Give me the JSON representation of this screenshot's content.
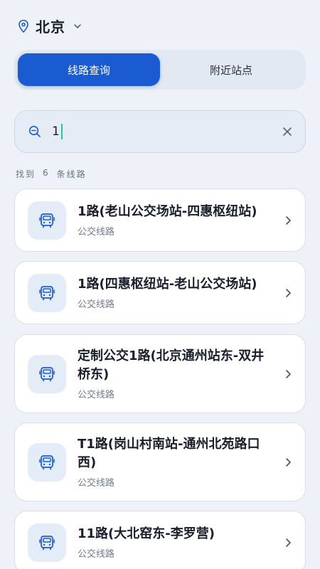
{
  "city": {
    "name": "北京"
  },
  "tabs": [
    {
      "label": "线路查询",
      "active": true
    },
    {
      "label": "附近站点",
      "active": false
    }
  ],
  "search": {
    "value": "1",
    "placeholder": ""
  },
  "results": {
    "prefix": "找到",
    "count": "6",
    "suffix": "条线路"
  },
  "routes": [
    {
      "name": "1路(老山公交场站-四惠枢纽站)",
      "type": "公交线路"
    },
    {
      "name": "1路(四惠枢纽站-老山公交场站)",
      "type": "公交线路"
    },
    {
      "name": "定制公交1路(北京通州站东-双井桥东)",
      "type": "公交线路"
    },
    {
      "name": "T1路(岗山村南站-通州北苑路口西)",
      "type": "公交线路"
    },
    {
      "name": "11路(大北窑东-李罗营)",
      "type": "公交线路"
    }
  ],
  "colors": {
    "accent": "#1b5bd1",
    "background": "#eef2f8",
    "caret": "#1fc7a7"
  },
  "icons": {
    "city": "location-pin-icon",
    "dropdown": "chevron-down-icon",
    "search": "search-icon",
    "clear": "close-icon",
    "route": "bus-icon",
    "open": "chevron-right-icon"
  }
}
